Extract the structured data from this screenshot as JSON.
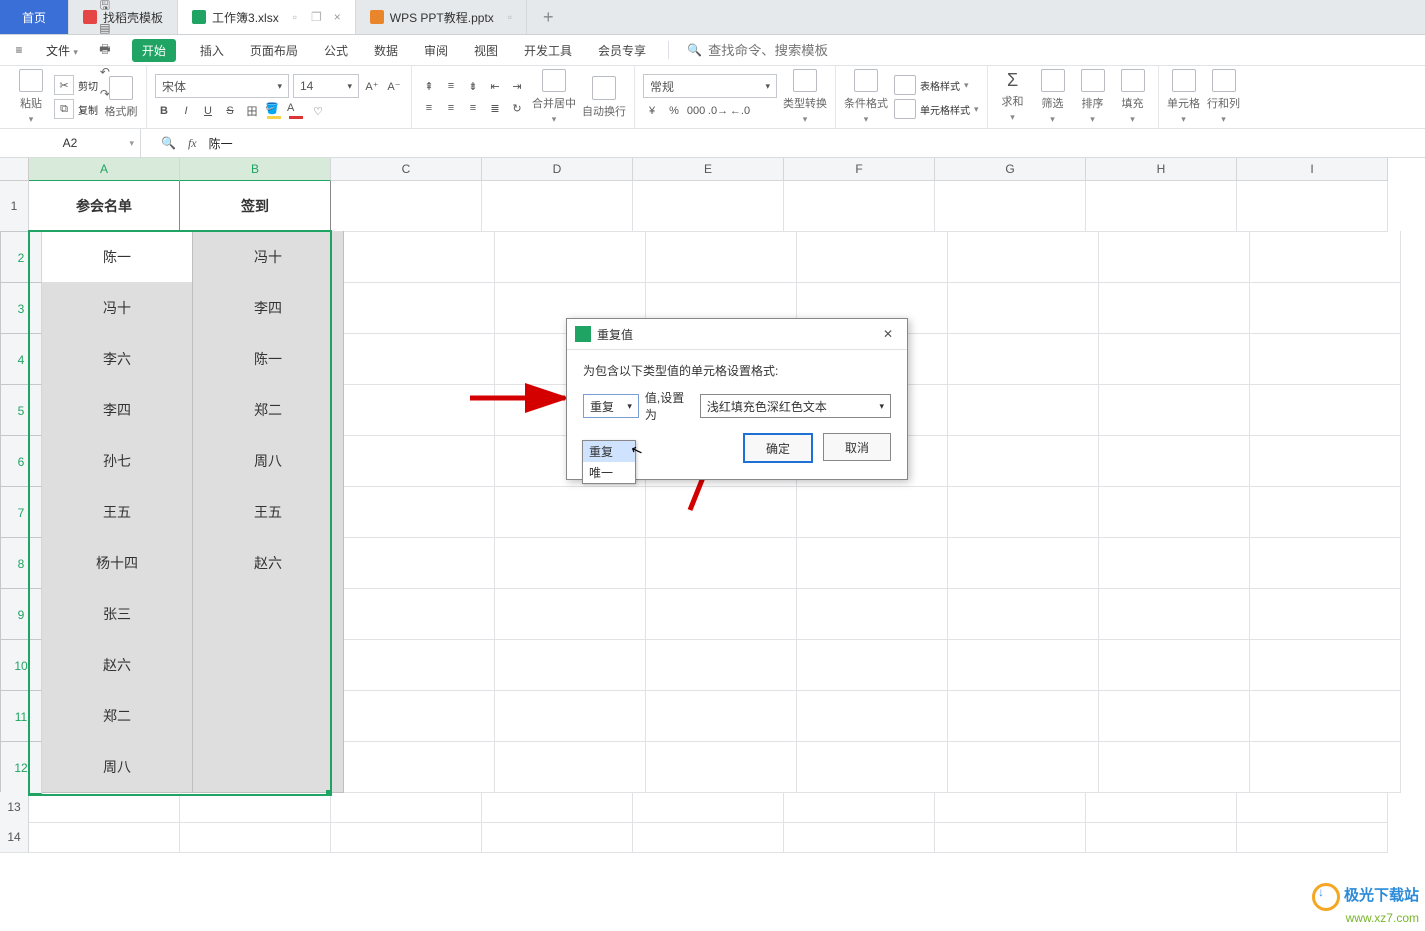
{
  "tabs": {
    "home": "首页",
    "doke": "找稻壳模板",
    "xlsx": "工作簿3.xlsx",
    "ppt": "WPS PPT教程.pptx"
  },
  "menu": {
    "file": "文件",
    "start": "开始",
    "items": [
      "插入",
      "页面布局",
      "公式",
      "数据",
      "审阅",
      "视图",
      "开发工具",
      "会员专享"
    ],
    "search_placeholder": "查找命令、搜索模板"
  },
  "ribbon": {
    "paste": "粘贴",
    "cut": "剪切",
    "copy": "复制",
    "format_painter": "格式刷",
    "font_name": "宋体",
    "font_size": "14",
    "merge_center": "合并居中",
    "wrap_text": "自动换行",
    "number_format": "常规",
    "type_convert": "类型转换",
    "cond_fmt": "条件格式",
    "table_style": "表格样式",
    "cell_style": "单元格样式",
    "sum": "求和",
    "filter": "筛选",
    "sort": "排序",
    "fill": "填充",
    "cells": "单元格",
    "rowcol": "行和列"
  },
  "namebox": "A2",
  "formula_value": "陈一",
  "fx": "fx",
  "headers": {
    "a": "参会名单",
    "b": "签到"
  },
  "rows": [
    {
      "a": "陈一",
      "b": "冯十"
    },
    {
      "a": "冯十",
      "b": "李四"
    },
    {
      "a": "李六",
      "b": "陈一"
    },
    {
      "a": "李四",
      "b": "郑二"
    },
    {
      "a": "孙七",
      "b": "周八"
    },
    {
      "a": "王五",
      "b": "王五"
    },
    {
      "a": "杨十四",
      "b": "赵六"
    },
    {
      "a": "张三",
      "b": ""
    },
    {
      "a": "赵六",
      "b": ""
    },
    {
      "a": "郑二",
      "b": ""
    },
    {
      "a": "周八",
      "b": ""
    }
  ],
  "col_letters": [
    "A",
    "B",
    "C",
    "D",
    "E",
    "F",
    "G",
    "H",
    "I"
  ],
  "dialog": {
    "title": "重复值",
    "desc": "为包含以下类型值的单元格设置格式:",
    "type_value": "重复",
    "mid_label": "值,设置为",
    "style_value": "浅红填充色深红色文本",
    "options": {
      "dup": "重复",
      "uni": "唯一"
    },
    "ok": "确定",
    "cancel": "取消"
  },
  "watermark": {
    "a": "极光下载站",
    "b": "www.xz7.com"
  }
}
